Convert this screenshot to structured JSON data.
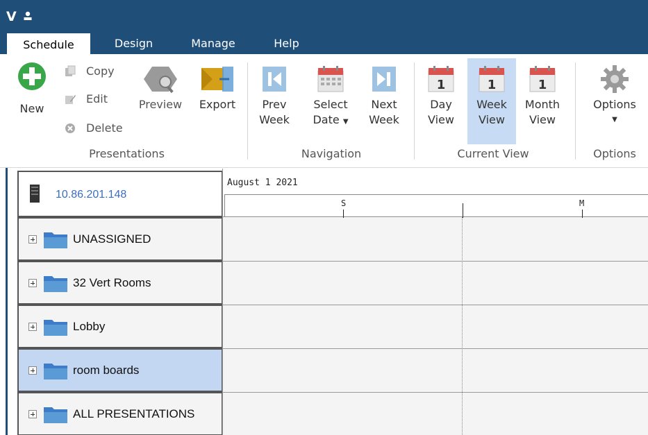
{
  "titlebar": {
    "app_letter": "V"
  },
  "tabs": [
    {
      "label": "Schedule",
      "active": true
    },
    {
      "label": "Design",
      "active": false
    },
    {
      "label": "Manage",
      "active": false
    },
    {
      "label": "Help",
      "active": false
    }
  ],
  "ribbon": {
    "presentations": {
      "new": "New",
      "copy": "Copy",
      "edit": "Edit",
      "delete": "Delete",
      "preview": "Preview",
      "export": "Export",
      "group_label": "Presentations"
    },
    "navigation": {
      "prev_week_line1": "Prev",
      "prev_week_line2": "Week",
      "select_date_line1": "Select",
      "select_date_line2": "Date",
      "next_week_line1": "Next",
      "next_week_line2": "Week",
      "group_label": "Navigation"
    },
    "current_view": {
      "day_line1": "Day",
      "day_line2": "View",
      "week_line1": "Week",
      "week_line2": "View",
      "month_line1": "Month",
      "month_line2": "View",
      "calendar_day_number": "1",
      "group_label": "Current View",
      "selected": "Week View"
    },
    "options": {
      "label": "Options",
      "group_label": "Options"
    }
  },
  "tree": {
    "server": "10.86.201.148",
    "items": [
      {
        "label": "UNASSIGNED",
        "selected": false
      },
      {
        "label": "32 Vert Rooms",
        "selected": false
      },
      {
        "label": "Lobby",
        "selected": false
      },
      {
        "label": "room boards",
        "selected": true
      },
      {
        "label": "ALL PRESENTATIONS",
        "selected": false
      }
    ]
  },
  "calendar": {
    "date_header": "August 1 2021",
    "days": [
      "S",
      "M"
    ]
  },
  "colors": {
    "titlebar": "#1f4e79",
    "selected_row": "#c4d7f2",
    "selected_ribbon_button": "#c7dcf4",
    "link_blue": "#3a6ebf",
    "calendar_red": "#d9534f"
  }
}
